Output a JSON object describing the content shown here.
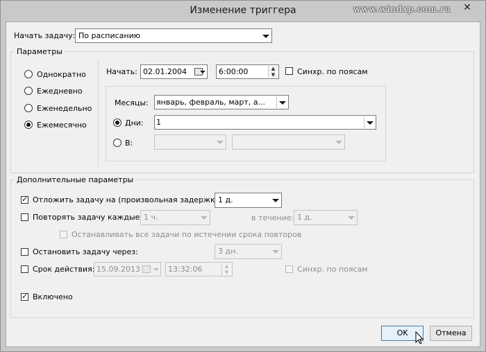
{
  "window": {
    "title": "Изменение триггера",
    "watermark": "www.windxp.com.ru",
    "close_glyph": "✕"
  },
  "begin": {
    "label": "Начать задачу:",
    "value": "По расписанию"
  },
  "params": {
    "caption": "Параметры",
    "radios": [
      "Однократно",
      "Ежедневно",
      "Еженедельно",
      "Ежемесячно"
    ],
    "selected": "Ежемесячно",
    "start_label": "Начать:",
    "start_date": "02.01.2004",
    "start_time": "6:00:00",
    "sync_label": "Синхр. по поясам",
    "months_label": "Месяцы:",
    "months_value": "январь, февраль, март, а...",
    "days_label": "Дни:",
    "days_value": "1",
    "on_label": "В:"
  },
  "advanced": {
    "caption": "Дополнительные параметры",
    "delay_label": "Отложить задачу на (произвольная задержка):",
    "delay_value": "1 д.",
    "delay_checked": true,
    "repeat_label": "Повторять задачу каждые:",
    "repeat_value": "1 ч.",
    "duration_label": "в течение:",
    "duration_value": "1 д.",
    "stop_all_label": "Останавливать все задачи по истечении срока повторов",
    "stop_label": "Остановить задачу через:",
    "stop_value": "3 дн.",
    "expire_label": "Срок действия:",
    "expire_date": "15.09.2013",
    "expire_time": "13:32:06",
    "expire_sync_label": "Синхр. по поясам",
    "enabled_label": "Включено",
    "enabled_checked": true
  },
  "buttons": {
    "ok": "OK",
    "cancel": "Отмена"
  }
}
